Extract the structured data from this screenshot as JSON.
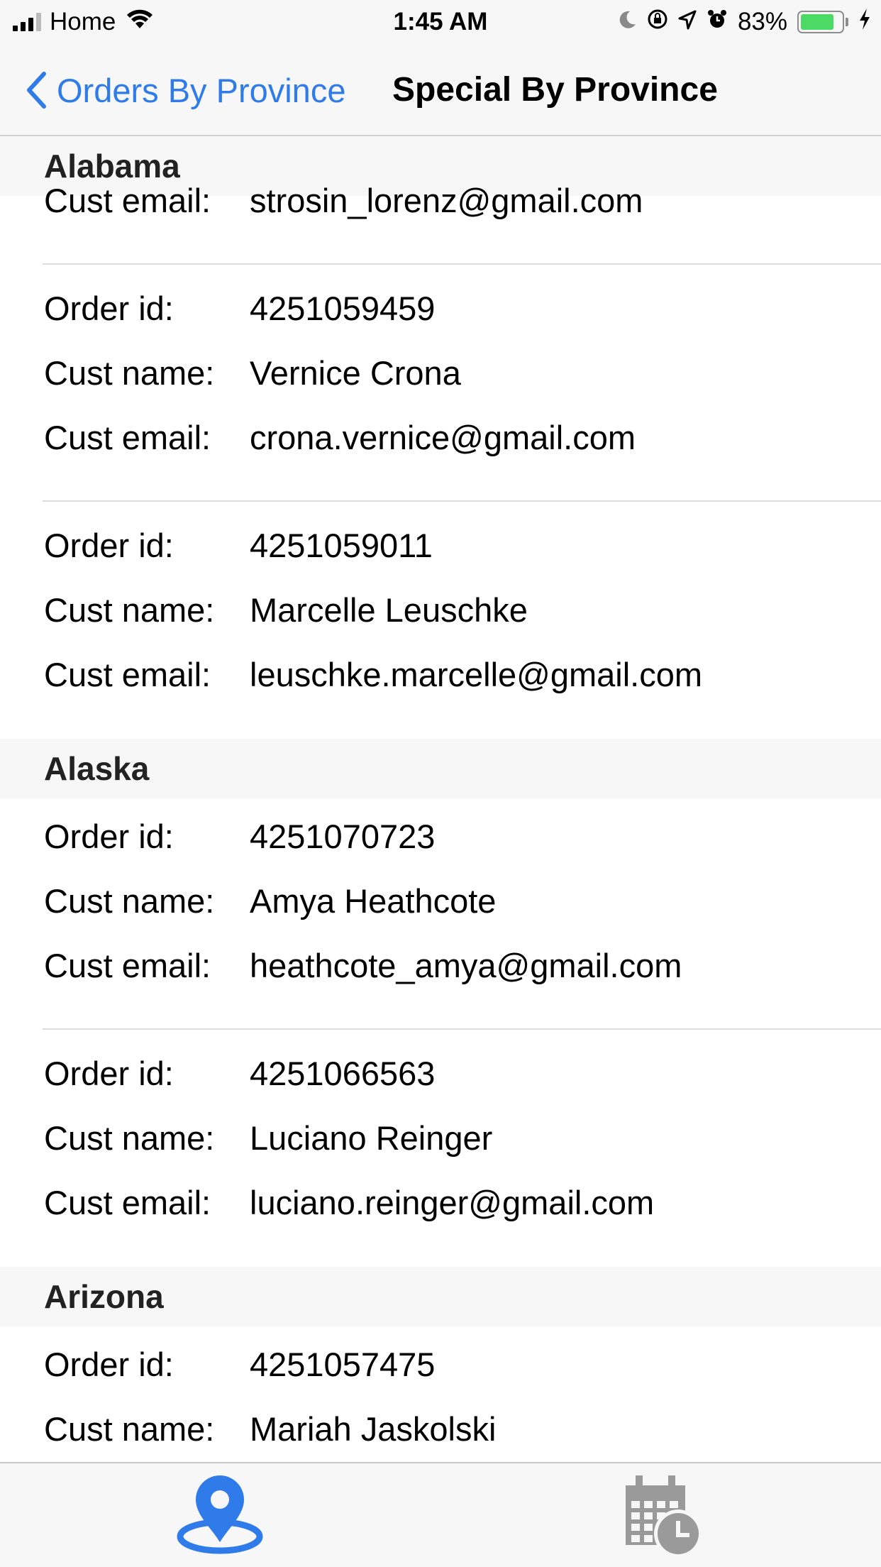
{
  "status_bar": {
    "carrier": "Home",
    "time": "1:45 AM",
    "battery_percent": "83%",
    "battery_level": 0.83,
    "icons": [
      "signal-icon",
      "wifi-icon",
      "moon-icon",
      "orientation-lock-icon",
      "location-icon",
      "alarm-icon",
      "battery-icon",
      "charging-icon"
    ]
  },
  "nav": {
    "back_label": "Orders By Province",
    "title": "Special By Province"
  },
  "labels": {
    "order_id": "Order id:",
    "cust_name": "Cust name:",
    "cust_email": "Cust email:"
  },
  "sections": [
    {
      "province": "Alabama",
      "partial_email": "strosin_lorenz@gmail.com",
      "orders": [
        {
          "order_id": "4251059459",
          "cust_name": "Vernice Crona",
          "cust_email": "crona.vernice@gmail.com"
        },
        {
          "order_id": "4251059011",
          "cust_name": "Marcelle Leuschke",
          "cust_email": "leuschke.marcelle@gmail.com"
        }
      ]
    },
    {
      "province": "Alaska",
      "orders": [
        {
          "order_id": "4251070723",
          "cust_name": "Amya Heathcote",
          "cust_email": "heathcote_amya@gmail.com"
        },
        {
          "order_id": "4251066563",
          "cust_name": "Luciano Reinger",
          "cust_email": "luciano.reinger@gmail.com"
        }
      ]
    },
    {
      "province": "Arizona",
      "orders": [
        {
          "order_id": "4251057475",
          "cust_name": "Mariah Jaskolski",
          "cust_email": ""
        }
      ]
    }
  ],
  "tabbar": {
    "tabs": [
      {
        "icon": "location-pin-icon",
        "selected": true
      },
      {
        "icon": "calendar-clock-icon",
        "selected": false
      }
    ]
  },
  "colors": {
    "accent": "#2f7bea",
    "section_bg": "#f7f7f7",
    "separator": "#dcdcdc"
  }
}
